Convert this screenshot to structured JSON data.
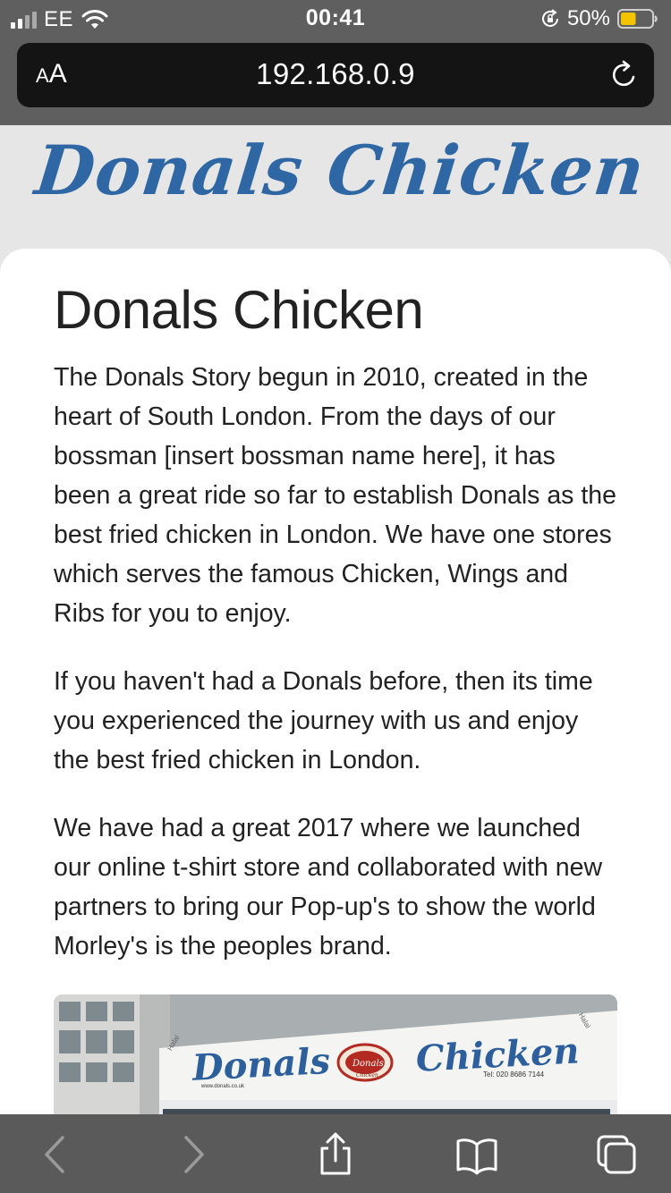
{
  "status_bar": {
    "carrier": "EE",
    "time": "00:41",
    "battery_percent": "50%",
    "battery_level": 0.5,
    "battery_color": "#f5c400",
    "signal_bars": 2
  },
  "browser": {
    "aa_big": "A",
    "aa_small": "A",
    "url": "192.168.0.9"
  },
  "site": {
    "logo": "Donals Chicken",
    "brand_color": "#2f67a5"
  },
  "article": {
    "title": "Donals Chicken",
    "paragraphs": [
      "The Donals Story begun in 2010, created in the heart of South London. From the days of our bossman [insert bossman name here], it has been a great ride so far to establish Donals as the best fried chicken in London. We have one stores which serves the famous Chicken, Wings and Ribs for you to enjoy.",
      "If you haven't had a Donals before, then its time you experienced the journey with us and enjoy the best fried chicken in London.",
      "We have had a great 2017 where we launched our online t-shirt store and collaborated with new partners to bring our Pop-up's to show the world Morley's is the peoples brand."
    ]
  },
  "photo_sign": {
    "left_word": "Donals",
    "right_word": "Chicken",
    "badge": "Donals",
    "badge_sub": "Chicken",
    "phone": "Tel: 020 8686 7144",
    "website": "www.donals.co.uk",
    "halal_left": "Halal",
    "halal_right": "Halal"
  },
  "toolbar": {
    "icons": [
      "chevron-left-icon",
      "chevron-right-icon",
      "share-icon",
      "bookmarks-icon",
      "tabs-icon"
    ]
  }
}
